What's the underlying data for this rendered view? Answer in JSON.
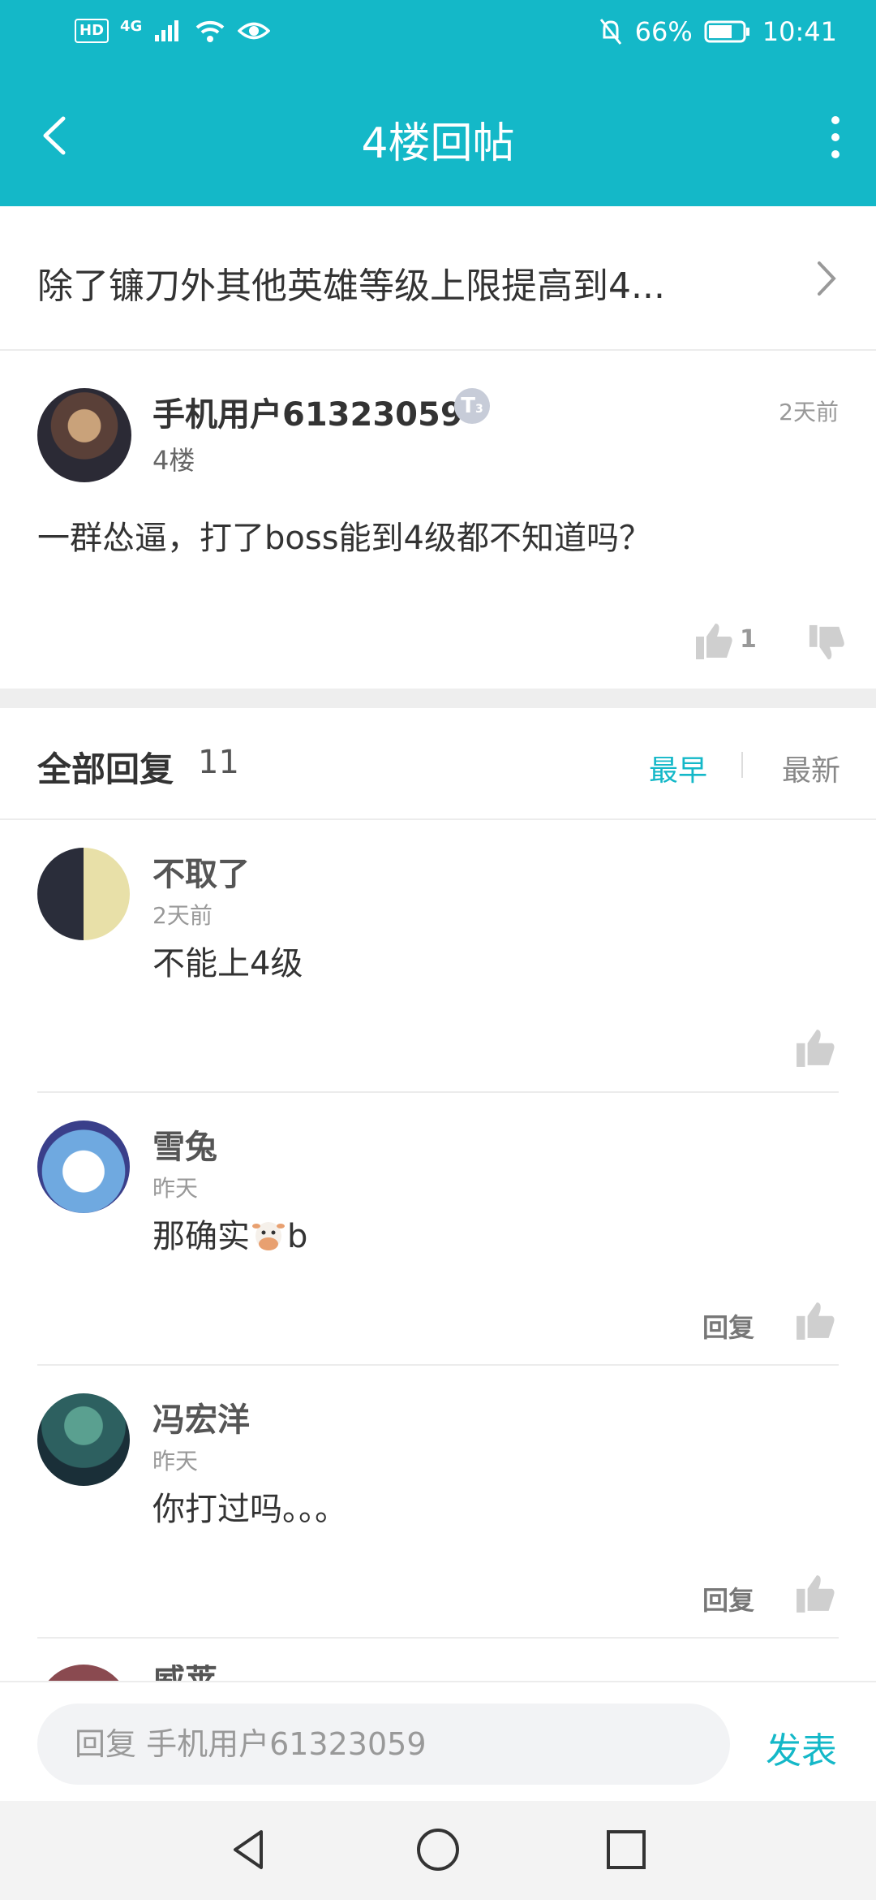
{
  "status_bar": {
    "hd": "HD",
    "signal": "4G",
    "battery_percent": "66%",
    "time": "10:41"
  },
  "app_bar": {
    "title": "4楼回帖"
  },
  "topic": {
    "title": "除了镰刀外其他英雄等级上限提高到4..."
  },
  "post": {
    "author": "手机用户61323059",
    "badge": "T",
    "badge_level": "3",
    "floor": "4楼",
    "time": "2天前",
    "content": "一群怂逼，打了boss能到4级都不知道吗？",
    "like_count": "1"
  },
  "replies_header": {
    "label": "全部回复",
    "count": "11",
    "sort_earliest": "最早",
    "sort_newest": "最新"
  },
  "replies": [
    {
      "name": "不取了",
      "time": "2天前",
      "content": "不能上4级",
      "reply_label": "",
      "avatar_color": "#2a2d3a"
    },
    {
      "name": "雪兔",
      "time": "昨天",
      "content_before": "那确实",
      "content_after": "b",
      "reply_label": "回复",
      "avatar_color": "#6fa9e0"
    },
    {
      "name": "冯宏洋",
      "time": "昨天",
      "content": "你打过吗。。。",
      "reply_label": "回复",
      "avatar_color": "#1f4b4a"
    },
    {
      "name": "威莱"
    }
  ],
  "input": {
    "placeholder": "回复 手机用户61323059",
    "send_label": "发表"
  },
  "colors": {
    "accent": "#14b8c8"
  }
}
